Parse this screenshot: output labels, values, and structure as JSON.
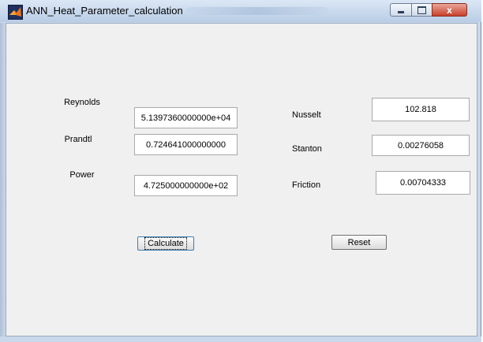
{
  "window": {
    "title": "ANN_Heat_Parameter_calculation",
    "controls": {
      "minimize": "minimize",
      "maximize": "maximize",
      "close": "x"
    }
  },
  "inputs": {
    "reynolds": {
      "label": "Reynolds",
      "value": "5.1397360000000e+04"
    },
    "prandtl": {
      "label": "Prandtl",
      "value": "0.724641000000000"
    },
    "power": {
      "label": "Power",
      "value": "4.725000000000e+02"
    }
  },
  "outputs": {
    "nusselt": {
      "label": "Nusselt",
      "value": "102.818"
    },
    "stanton": {
      "label": "Stanton",
      "value": "0.00276058"
    },
    "friction": {
      "label": "Friction",
      "value": "0.00704333"
    }
  },
  "buttons": {
    "calculate": "Calculate",
    "reset": "Reset"
  },
  "colors": {
    "frame": "#c9d8ea",
    "panel": "#f0f0f0",
    "close_button": "#c8412a"
  },
  "icons": {
    "app": "matlab-membrane-icon",
    "close": "close-icon"
  }
}
